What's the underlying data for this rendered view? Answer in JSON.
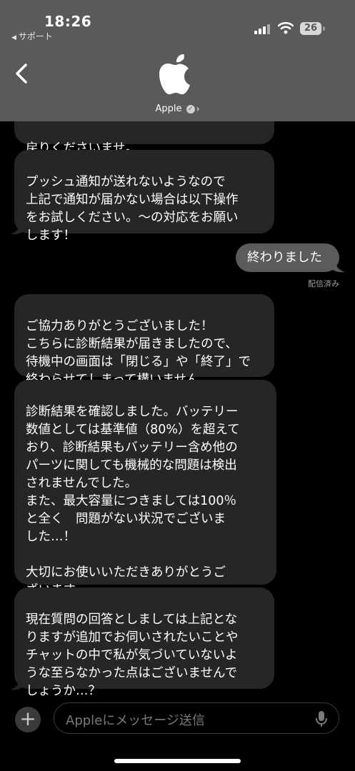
{
  "status_bar": {
    "time": "18:26",
    "back_app": "サポート",
    "battery": "26"
  },
  "header": {
    "contact_name": "Apple",
    "logo_icon": "apple-logo-icon"
  },
  "messages": [
    {
      "from": "agent",
      "text": "戻りくださいませ。"
    },
    {
      "from": "agent",
      "text": "プッシュ通知が送れないようなので\n上記で通知が届かない場合は以下操作\nをお試しください。〜の対応をお願い\nします！"
    },
    {
      "from": "user",
      "text": "終わりました"
    },
    {
      "from": "agent",
      "text": "ご協力ありがとうございました！\nこちらに診断結果が届きましたので、\n待機中の画面は「閉じる」や「終了」で\n終わらせてしまって構いません。"
    },
    {
      "from": "agent",
      "text": "診断結果を確認しました。バッテリー\n数値としては基準値（80%）を超えて\nおり、診断結果もバッテリー含め他の\nパーツに関しても機械的な問題は検出\nされませんでした。\nまた、最大容量につきましては100％\nと全く　問題がない状況でございま\nした…！\n\n大切にお使いいただきありがとうご\nざいます。"
    },
    {
      "from": "agent",
      "text": "現在質問の回答としましては上記とな\nりますが追加でお伺いされたいことや\nチャットの中で私が気づいていないよ\nうな至らなかった点はございませんで\nしょうか…？"
    }
  ],
  "delivered_label": "配信済み",
  "composer": {
    "placeholder": "Appleにメッセージ送信",
    "plus_icon": "plus-icon",
    "mic_icon": "microphone-icon"
  },
  "colors": {
    "header_bg": "#5a5a5c",
    "received_bubble": "#262628",
    "sent_bubble": "#5b5b5e"
  }
}
